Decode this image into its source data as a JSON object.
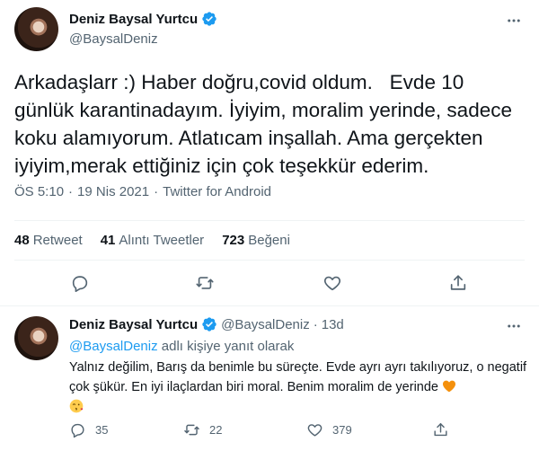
{
  "main_tweet": {
    "author_name": "Deniz Baysal Yurtcu",
    "author_handle": "@BaysalDeniz",
    "text": "Arkadaşlarr :) Haber doğru,covid oldum.   Evde 10 günlük karantinadayım. İyiyim, moralim yerinde, sadece koku alamıyorum. Atlatıcam inşallah. Ama gerçekten iyiyim,merak ettiğiniz için çok teşekkür ederim.",
    "time": "ÖS 5:10",
    "dot1": "·",
    "date": "19 Nis 2021",
    "dot2": "·",
    "source": "Twitter for Android",
    "stats": {
      "retweets_count": "48",
      "retweets_label": "Retweet",
      "quotes_count": "41",
      "quotes_label": "Alıntı Tweetler",
      "likes_count": "723",
      "likes_label": "Beğeni"
    },
    "icons": {
      "verified": "verified-badge-icon",
      "more": "more-dots-icon",
      "reply": "reply-icon",
      "retweet": "retweet-icon",
      "like": "heart-icon",
      "share": "share-icon"
    }
  },
  "reply_tweet": {
    "author_name": "Deniz Baysal Yurtcu",
    "author_handle": "@BaysalDeniz",
    "dot": "·",
    "age": "13d",
    "reply_to_handle": "@BaysalDeniz",
    "reply_to_suffix": " adlı kişiye yanıt olarak",
    "text": "Yalnız değilim, Barış da benimle bu süreçte. Evde ayrı ayrı takılıyoruz, o negatif çok şükür. En iyi ilaçlardan biri moral. Benim moralim de yerinde",
    "emojis": [
      "orange-heart-emoji",
      "face-blowing-kiss-emoji"
    ],
    "replies_count": "35",
    "retweets_count": "22",
    "likes_count": "379"
  },
  "colors": {
    "accent": "#1d9bf0",
    "muted_text": "#536471",
    "body_text": "#0f1419",
    "divider": "#eff3f4",
    "heart_emoji": "#f4900c"
  }
}
